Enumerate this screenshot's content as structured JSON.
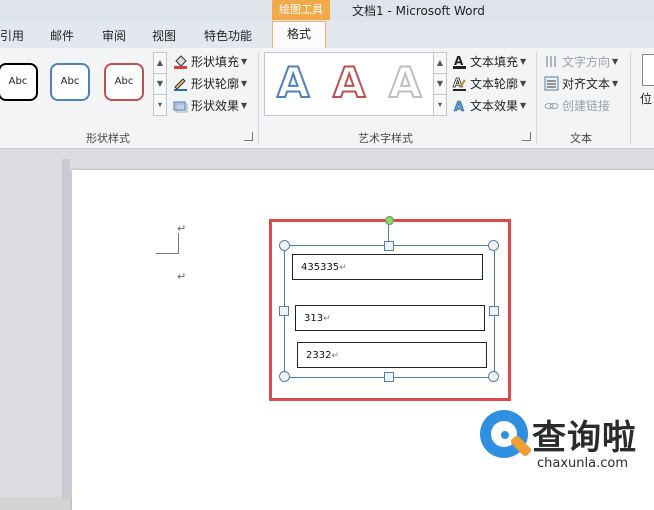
{
  "titlebar": {
    "context_tab": "绘图工具",
    "document_title": "文档1  -  Microsoft Word"
  },
  "tabs": {
    "reference": "引用",
    "mailings": "邮件",
    "review": "审阅",
    "view": "视图",
    "features": "特色功能",
    "format": "格式"
  },
  "ribbon": {
    "shape_styles": {
      "label": "形状样式",
      "samples": [
        "Abc",
        "Abc",
        "Abc"
      ],
      "sample_colors": [
        "#000000",
        "#4f81bd",
        "#c0504d"
      ],
      "fill": "形状填充",
      "outline": "形状轮廓",
      "effects": "形状效果"
    },
    "wordart_styles": {
      "label": "艺术字样式",
      "letters": [
        "A",
        "A",
        "A"
      ],
      "letter_colors": [
        "#4f81bd",
        "#c0504d",
        "#bfbfbf"
      ],
      "text_fill": "文本填充",
      "text_outline": "文本轮廓",
      "text_effects": "文本效果"
    },
    "text_group": {
      "label": "文本",
      "direction": "文字方向",
      "align": "对齐文本",
      "create_link": "创建链接"
    },
    "position": {
      "label": "位"
    }
  },
  "document": {
    "textboxes": [
      {
        "text": "435335"
      },
      {
        "text": "313"
      },
      {
        "text": "2332"
      }
    ],
    "return_mark": "↵"
  },
  "watermark": {
    "cn": "查询啦",
    "en": "chaxunla.com"
  },
  "colors": {
    "context_tab": "#f2a94a",
    "highlight": "#dd4a4a",
    "selection": "#4d7ea6"
  }
}
